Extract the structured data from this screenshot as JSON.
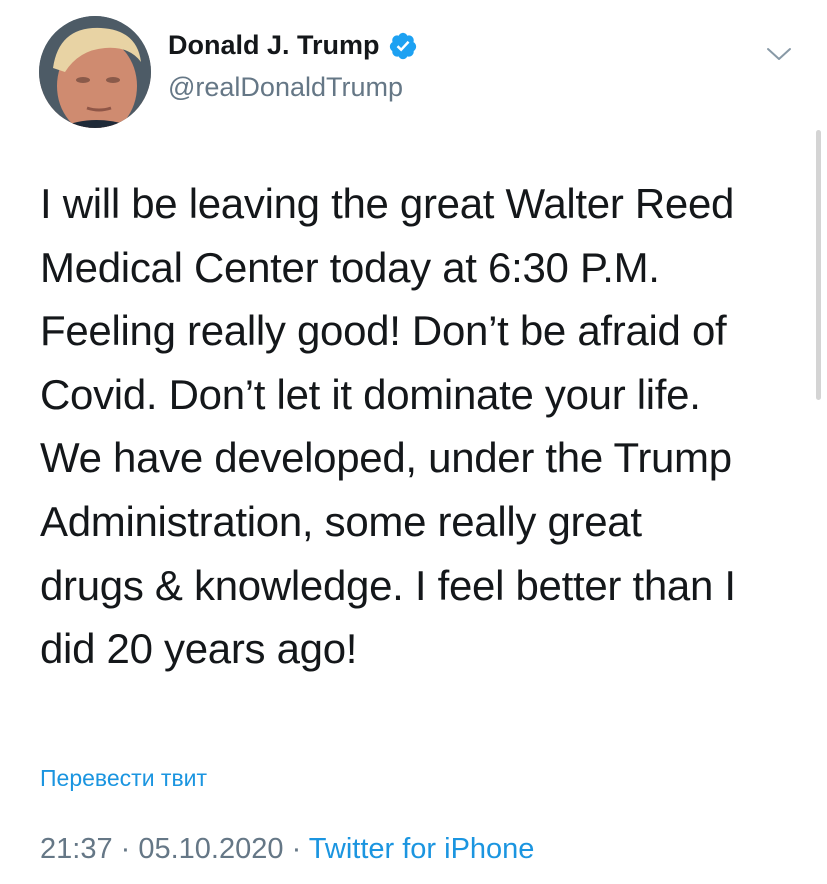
{
  "user": {
    "display_name": "Donald J. Trump",
    "handle": "@realDonaldTrump",
    "verified": true,
    "avatar_icon": "profile-photo"
  },
  "tweet": {
    "lines": [
      "I will be leaving the great Walter Reed",
      "Medical Center today at 6:30 P.M.",
      "Feeling really good! Don’t be afraid of",
      "Covid. Don’t let it dominate your life.",
      "We have developed, under the Trump",
      "Administration, some really great",
      "drugs & knowledge. I feel better than I",
      "did 20 years ago!"
    ]
  },
  "translate_label": "Перевести твит",
  "meta": {
    "time": "21:37",
    "separator": " · ",
    "date": "05.10.2020",
    "source": "Twitter for iPhone"
  },
  "icons": {
    "verified": "verified-badge-icon",
    "menu": "chevron-down-icon"
  },
  "colors": {
    "link_blue": "#1b95e0",
    "text": "#14171a",
    "secondary": "#657786"
  }
}
